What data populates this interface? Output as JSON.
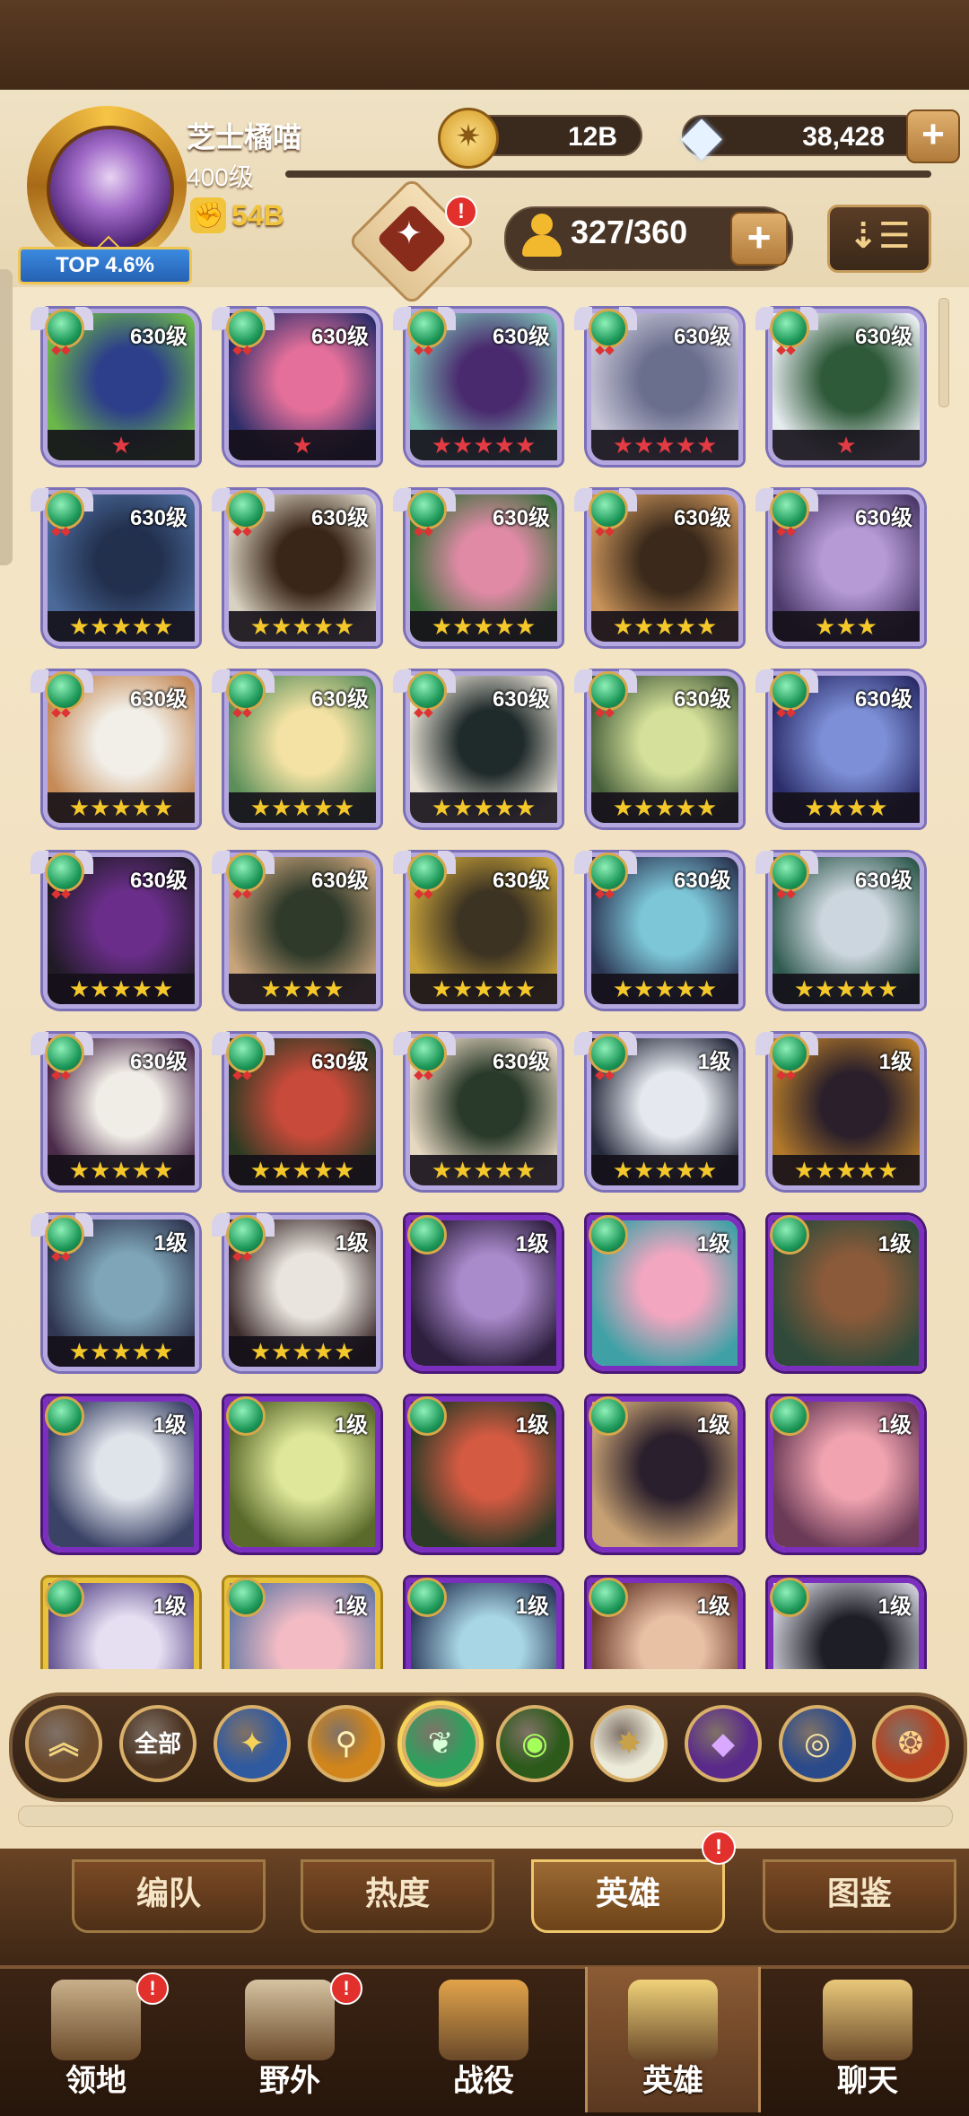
{
  "player": {
    "name": "芝士橘喵",
    "level": "400级",
    "power": "54B",
    "rank_badge": "TOP 4.6%"
  },
  "currency": {
    "gold": "12B",
    "gems": "38,428",
    "add_label": "+"
  },
  "roster": {
    "count": "327/360",
    "add_label": "+",
    "notif": "!",
    "sort_icon": "sort-down-icon"
  },
  "heroes": [
    {
      "level": "630级",
      "frame": "silver",
      "stars": "★",
      "star_color": "red",
      "art": [
        "#2d3f8a",
        "#6bb84a"
      ]
    },
    {
      "level": "630级",
      "frame": "silver",
      "stars": "★",
      "star_color": "red",
      "art": [
        "#e36f9a",
        "#2c2e6a"
      ]
    },
    {
      "level": "630级",
      "frame": "silver",
      "stars": "★★★★★",
      "star_color": "red",
      "art": [
        "#4a2a6e",
        "#7dc0b6"
      ]
    },
    {
      "level": "630级",
      "frame": "silver",
      "stars": "★★★★★",
      "star_color": "red",
      "art": [
        "#6a6f8e",
        "#c9c6d8"
      ]
    },
    {
      "level": "630级",
      "frame": "silver",
      "stars": "★",
      "star_color": "red",
      "art": [
        "#2f5a3a",
        "#e7ecef"
      ]
    },
    {
      "level": "630级",
      "frame": "silver",
      "stars": "★★★★★",
      "star_color": "gold",
      "art": [
        "#22304e",
        "#4b6a9a"
      ]
    },
    {
      "level": "630级",
      "frame": "silver",
      "stars": "★★★★★",
      "star_color": "gold",
      "art": [
        "#3a2618",
        "#d9d2c2"
      ]
    },
    {
      "level": "630级",
      "frame": "silver",
      "stars": "★★★★★",
      "star_color": "gold",
      "art": [
        "#e08aa6",
        "#3a6f3a"
      ]
    },
    {
      "level": "630级",
      "frame": "silver",
      "stars": "★★★★★",
      "star_color": "gold",
      "art": [
        "#3b2a1b",
        "#c9935a"
      ]
    },
    {
      "level": "630级",
      "frame": "silver",
      "stars": "★★★",
      "star_color": "gold",
      "art": [
        "#b59ad6",
        "#4c3a6a"
      ]
    },
    {
      "level": "630级",
      "frame": "silver",
      "stars": "★★★★★",
      "star_color": "gold",
      "art": [
        "#f1efe8",
        "#c68a56"
      ]
    },
    {
      "level": "630级",
      "frame": "silver",
      "stars": "★★★★★",
      "star_color": "gold",
      "art": [
        "#f3e2a3",
        "#5b8f5a"
      ]
    },
    {
      "level": "630级",
      "frame": "silver",
      "stars": "★★★★★",
      "star_color": "gold",
      "art": [
        "#1f2a2a",
        "#e9e3d6"
      ]
    },
    {
      "level": "630级",
      "frame": "silver",
      "stars": "★★★★★",
      "star_color": "gold",
      "art": [
        "#d5e19a",
        "#455d3a"
      ]
    },
    {
      "level": "630级",
      "frame": "silver",
      "stars": "★★★★",
      "star_color": "gold",
      "art": [
        "#7d8fd6",
        "#2b2d6a"
      ]
    },
    {
      "level": "630级",
      "frame": "silver",
      "stars": "★★★★★",
      "star_color": "gold",
      "art": [
        "#6a2e8a",
        "#1f1a24"
      ]
    },
    {
      "level": "630级",
      "frame": "silver",
      "stars": "★★★★",
      "star_color": "gold",
      "art": [
        "#2f3a2a",
        "#c9a57c"
      ]
    },
    {
      "level": "630级",
      "frame": "silver",
      "stars": "★★★★★",
      "star_color": "gold",
      "art": [
        "#3d3322",
        "#c7a23a"
      ]
    },
    {
      "level": "630级",
      "frame": "silver",
      "stars": "★★★★★",
      "star_color": "gold",
      "art": [
        "#7cc6d8",
        "#2b3552"
      ]
    },
    {
      "level": "630级",
      "frame": "silver",
      "stars": "★★★★★",
      "star_color": "gold",
      "art": [
        "#ccd6de",
        "#2f5a4e"
      ]
    },
    {
      "level": "630级",
      "frame": "silver",
      "stars": "★★★★★",
      "star_color": "gold",
      "art": [
        "#f0ece6",
        "#4b2a4a"
      ]
    },
    {
      "level": "630级",
      "frame": "silver",
      "stars": "★★★★★",
      "star_color": "gold",
      "art": [
        "#c84a3a",
        "#2b3a22"
      ]
    },
    {
      "level": "630级",
      "frame": "silver",
      "stars": "★★★★★",
      "star_color": "gold",
      "art": [
        "#2a3a2a",
        "#e7d8c2"
      ]
    },
    {
      "level": "1级",
      "frame": "silver",
      "stars": "★★★★★",
      "star_color": "gold",
      "art": [
        "#e5e8ee",
        "#23283a"
      ]
    },
    {
      "level": "1级",
      "frame": "silver",
      "stars": "★★★★★",
      "star_color": "gold",
      "art": [
        "#2a1f2a",
        "#b37a2a"
      ]
    },
    {
      "level": "1级",
      "frame": "silver",
      "stars": "★★★★★",
      "star_color": "gold",
      "art": [
        "#7fa6b8",
        "#2f3550"
      ]
    },
    {
      "level": "1级",
      "frame": "silver",
      "stars": "★★★★★",
      "star_color": "gold",
      "art": [
        "#e9e5de",
        "#3b2a2a"
      ]
    },
    {
      "level": "1级",
      "frame": "purple",
      "stars": "",
      "star_color": "gold",
      "art": [
        "#a98acb",
        "#2e1f3f"
      ]
    },
    {
      "level": "1级",
      "frame": "purple",
      "stars": "",
      "star_color": "gold",
      "art": [
        "#f3a6c0",
        "#3fa1a6"
      ]
    },
    {
      "level": "1级",
      "frame": "purple",
      "stars": "",
      "star_color": "gold",
      "art": [
        "#8a5a3a",
        "#2f4a3a"
      ]
    },
    {
      "level": "1级",
      "frame": "purple",
      "stars": "",
      "star_color": "gold",
      "art": [
        "#dfe3ea",
        "#3a4266"
      ]
    },
    {
      "level": "1级",
      "frame": "purple",
      "stars": "",
      "star_color": "gold",
      "art": [
        "#dfe89a",
        "#5a6a2a"
      ]
    },
    {
      "level": "1级",
      "frame": "purple",
      "stars": "",
      "star_color": "gold",
      "art": [
        "#d45a42",
        "#2c3a26"
      ]
    },
    {
      "level": "1级",
      "frame": "purple",
      "stars": "",
      "star_color": "gold",
      "art": [
        "#2a1f2c",
        "#c7a173"
      ]
    },
    {
      "level": "1级",
      "frame": "purple",
      "stars": "",
      "star_color": "gold",
      "art": [
        "#f1a4b0",
        "#6a3a56"
      ]
    },
    {
      "level": "1级",
      "frame": "gold",
      "stars": "",
      "star_color": "gold",
      "art": [
        "#e6dff2",
        "#5a4a8a"
      ]
    },
    {
      "level": "1级",
      "frame": "gold",
      "stars": "",
      "star_color": "gold",
      "art": [
        "#f3bcc4",
        "#6a7aa6"
      ]
    },
    {
      "level": "1级",
      "frame": "purple",
      "stars": "",
      "star_color": "gold",
      "art": [
        "#a8d6e4",
        "#2c3a5a"
      ]
    },
    {
      "level": "1级",
      "frame": "purple",
      "stars": "",
      "star_color": "gold",
      "art": [
        "#e8c0a4",
        "#6a3a2a"
      ]
    },
    {
      "level": "1级",
      "frame": "purple",
      "stars": "",
      "star_color": "gold",
      "art": [
        "#1e1e26",
        "#c9c9d4"
      ]
    }
  ],
  "filters": [
    {
      "name": "collapse",
      "label": "︽",
      "bg": "#6b4a2c",
      "color": "#f4d57e"
    },
    {
      "name": "all",
      "label": "全部",
      "bg": "#4a3220",
      "color": "#ffffff"
    },
    {
      "name": "lightbearer",
      "label": "✦",
      "bg": "#2f5aa0",
      "color": "#f6d25a"
    },
    {
      "name": "mauler",
      "label": "⚲",
      "bg": "#d1851a",
      "color": "#fff2b3"
    },
    {
      "name": "wilder",
      "label": "❦",
      "bg": "#2ea05e",
      "color": "#d8ffd8"
    },
    {
      "name": "graveborn",
      "label": "◉",
      "bg": "#2c5a1a",
      "color": "#a5ff5a"
    },
    {
      "name": "celestial",
      "label": "✸",
      "bg": "#ecead8",
      "color": "#c8a24a"
    },
    {
      "name": "hypogean",
      "label": "◆",
      "bg": "#5a2a8a",
      "color": "#d9a8ff"
    },
    {
      "name": "dimensional",
      "label": "◎",
      "bg": "#2a4a8a",
      "color": "#f6e4a4"
    },
    {
      "name": "draconis",
      "label": "❂",
      "bg": "#b8401e",
      "color": "#ffd28a"
    }
  ],
  "subtabs": [
    "编队",
    "热度",
    "英雄",
    "图鉴"
  ],
  "subtab_notif": "!",
  "nav": [
    {
      "label": "领地",
      "icon": "castle-icon",
      "notif": "!",
      "color": "#c9b08a"
    },
    {
      "label": "野外",
      "icon": "map-scroll-icon",
      "notif": "!",
      "color": "#d6c3a1"
    },
    {
      "label": "战役",
      "icon": "crossed-swords-icon",
      "notif": "",
      "color": "#e2a44a"
    },
    {
      "label": "英雄",
      "icon": "hero-helmet-icon",
      "notif": "",
      "color": "#f0d27a"
    },
    {
      "label": "聊天",
      "icon": "chat-bubble-icon",
      "notif": "",
      "color": "#e9c87a"
    }
  ]
}
